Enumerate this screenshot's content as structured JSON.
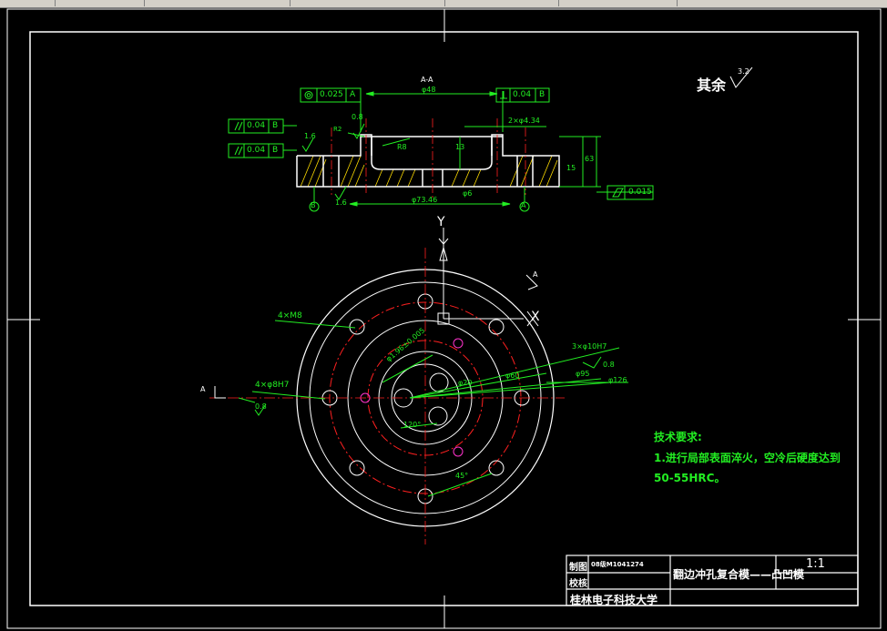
{
  "colors": {
    "background": "#000000",
    "outline": "#ffffff",
    "dimension": "#22ee22",
    "center_line": "#ff2020",
    "hatch": "#ffdd00",
    "magenta": "#ff33cc"
  },
  "surface_finish": {
    "label": "其余",
    "value": "3.2"
  },
  "section": {
    "label": "A-A"
  },
  "tolerances": {
    "coaxiality": {
      "value": "0.025",
      "datum": "A"
    },
    "perpendicularity": {
      "value": "0.04",
      "datum": "B"
    },
    "parallel_1": {
      "value": "0.04",
      "datum": "B"
    },
    "parallel_2": {
      "value": "0.04",
      "datum": "B"
    },
    "flatness": {
      "value": "0.015"
    }
  },
  "section_dims": {
    "top_dia": "φ48",
    "roughness_08": "0.8",
    "roughness_16a": "1.6",
    "roughness_16b": "1.6",
    "chamfer": "2×φ4.34",
    "r2": "R2",
    "r8": "R8",
    "h13": "13",
    "h15": "15",
    "h63": "63",
    "d6": "φ6",
    "d73": "φ73.46",
    "datum_a": "A",
    "datum_b": "B"
  },
  "plan_dims": {
    "axis_y": "Y",
    "axis_x": "X",
    "arrow_a": "A",
    "m8": "4×M8",
    "pin_holes": "4×φ8H7",
    "pin_rough": "0.8",
    "bolt_circle": "φ1.96±0.005",
    "holes_top": "3×φ10H7",
    "holes_rough": "0.8",
    "d20": "φ20",
    "d60": "φ60",
    "d95": "φ95",
    "d126": "φ126",
    "angle120": "120°",
    "angle45": "45°"
  },
  "tech_req": {
    "title": "技术要求:",
    "line1": "1.进行局部表面淬火，空冷后硬度达到",
    "line2": "50-55HRC。"
  },
  "title_block": {
    "draw_label": "制图",
    "student": "08级M1041274",
    "check_label": "校核",
    "drawing_title": "翻边冲孔复合模——凸凹模",
    "scale": "1:1",
    "school": "桂林电子科技大学"
  }
}
